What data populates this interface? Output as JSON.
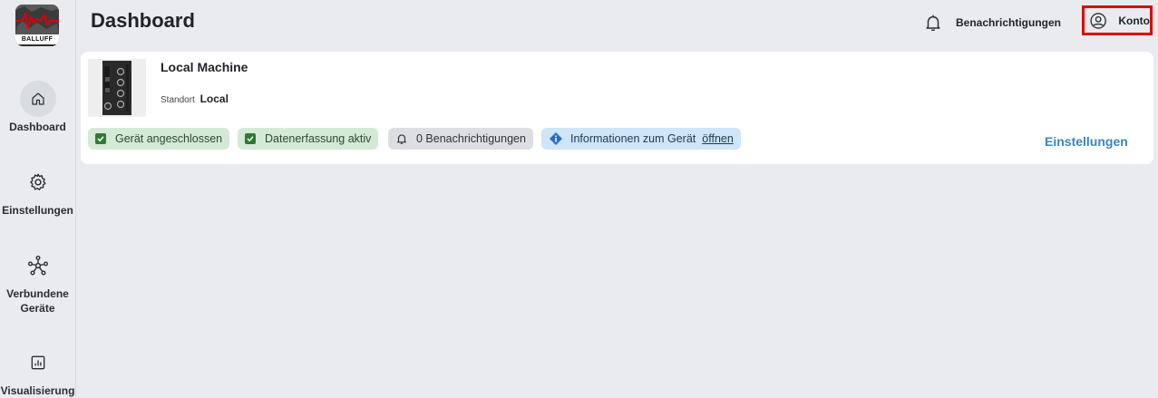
{
  "brand": {
    "logo_text": "BALLUFF",
    "accent": "#e00000"
  },
  "sidebar": {
    "items": [
      {
        "label": "Dashboard",
        "icon": "home-icon",
        "active": true
      },
      {
        "label": "Einstellungen",
        "icon": "gear-icon",
        "active": false
      },
      {
        "label": "Verbundene\nGeräte",
        "icon": "network-icon",
        "active": false
      },
      {
        "label": "Visualisierung",
        "icon": "chart-icon",
        "active": false
      }
    ]
  },
  "header": {
    "title": "Dashboard",
    "notifications_label": "Benachrichtigungen",
    "account_label": "Konto"
  },
  "device_card": {
    "name": "Local Machine",
    "location_label": "Standort",
    "location_value": "Local",
    "chips": {
      "connected": "Gerät angeschlossen",
      "data_capture": "Datenerfassung aktiv",
      "notifications": "0 Benachrichtigungen",
      "info": "Informationen zum Gerät",
      "info_link": "öffnen"
    },
    "settings_link": "Einstellungen"
  },
  "colors": {
    "chip_green": "#d4ead6",
    "chip_grey": "#dcdee1",
    "chip_blue": "#cfe5f8",
    "link_blue": "#3a86c0",
    "highlight": "#e00000"
  }
}
